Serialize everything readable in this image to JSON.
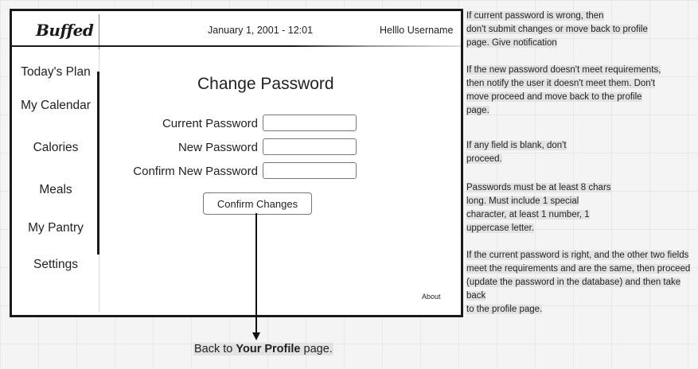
{
  "header": {
    "logo": "Buffed",
    "datetime": "January 1, 2001  -  12:01",
    "greeting": "Helllo Username"
  },
  "sidebar": {
    "items": [
      {
        "label": "Today's Plan"
      },
      {
        "label": "My Calendar"
      },
      {
        "label": "Calories"
      },
      {
        "label": "Meals"
      },
      {
        "label": "My Pantry"
      },
      {
        "label": "Settings"
      }
    ]
  },
  "main": {
    "title": "Change Password",
    "fields": [
      {
        "label": "Current Password",
        "value": ""
      },
      {
        "label": "New Password",
        "value": ""
      },
      {
        "label": "Confirm New Password",
        "value": ""
      }
    ],
    "confirm_label": "Confirm Changes",
    "about_label": "About"
  },
  "flow": {
    "back_prefix": "Back to ",
    "back_target": "Your Profile",
    "back_suffix": " page."
  },
  "notes": [
    {
      "lines": [
        "If current password is wrong, then",
        "don't submit changes or move back to profile",
        "page.  Give notification"
      ]
    },
    {
      "lines": [
        "If the new password doesn't meet requirements,",
        "then notify the user it doesn't meet them.  Don't",
        "move proceed and move back to the profile",
        "page."
      ]
    },
    {
      "lines": [
        "If any field is blank, don't",
        "proceed."
      ]
    },
    {
      "lines": [
        "Passwords must be at least 8 chars",
        "long.  Must include 1 special",
        "character, at least 1 number,  1",
        "uppercase letter."
      ]
    },
    {
      "lines": [
        "If the current password is right, and the other two fields",
        "meet the requirements and are the same, then proceed",
        "(update the password in the database) and then take back",
        "to the profile page."
      ]
    }
  ]
}
